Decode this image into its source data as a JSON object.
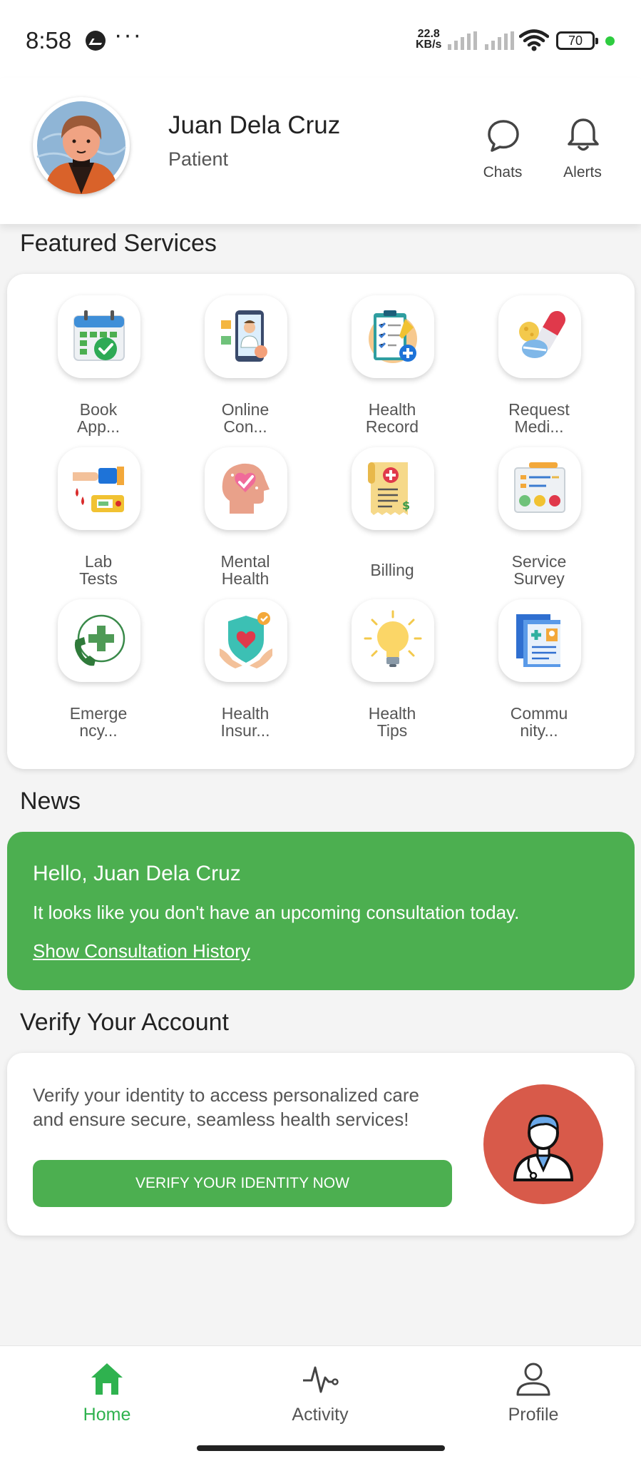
{
  "status_bar": {
    "time": "8:58",
    "dots": "···",
    "speed_value": "22.8",
    "speed_unit": "KB/s",
    "battery": "70"
  },
  "header": {
    "user_name": "Juan Dela Cruz",
    "user_role": "Patient",
    "chats_label": "Chats",
    "alerts_label": "Alerts"
  },
  "featured": {
    "title": "Featured Services",
    "services": [
      {
        "label": "Book\nApp...",
        "icon": "calendar-check-icon"
      },
      {
        "label": "Online\nCon...",
        "icon": "doctor-video-icon"
      },
      {
        "label": "Health\nRecord",
        "icon": "clipboard-icon"
      },
      {
        "label": "Request\nMedi...",
        "icon": "pills-icon"
      },
      {
        "label": "Lab\nTests",
        "icon": "blood-test-icon"
      },
      {
        "label": "Mental\nHealth",
        "icon": "mental-head-icon"
      },
      {
        "label": "Billing",
        "icon": "bill-icon"
      },
      {
        "label": "Service\nSurvey",
        "icon": "survey-icon"
      },
      {
        "label": "Emerge\nncy...",
        "icon": "emergency-phone-icon"
      },
      {
        "label": "Health\nInsur...",
        "icon": "shield-heart-icon"
      },
      {
        "label": "Health\nTips",
        "icon": "lightbulb-icon"
      },
      {
        "label": "Commu\nnity...",
        "icon": "documents-icon"
      }
    ]
  },
  "news": {
    "title": "News",
    "greeting": "Hello, Juan Dela Cruz",
    "message": "It looks like you don't have an upcoming consultation today.",
    "link": "Show Consultation History",
    "color": "#4caf50"
  },
  "verify": {
    "title": "Verify Your Account",
    "text": "Verify your identity to access personalized care and ensure secure, seamless health services!",
    "button": "VERIFY YOUR IDENTITY NOW"
  },
  "nav": {
    "home": "Home",
    "activity": "Activity",
    "profile": "Profile",
    "active_color": "#2fb24f"
  }
}
